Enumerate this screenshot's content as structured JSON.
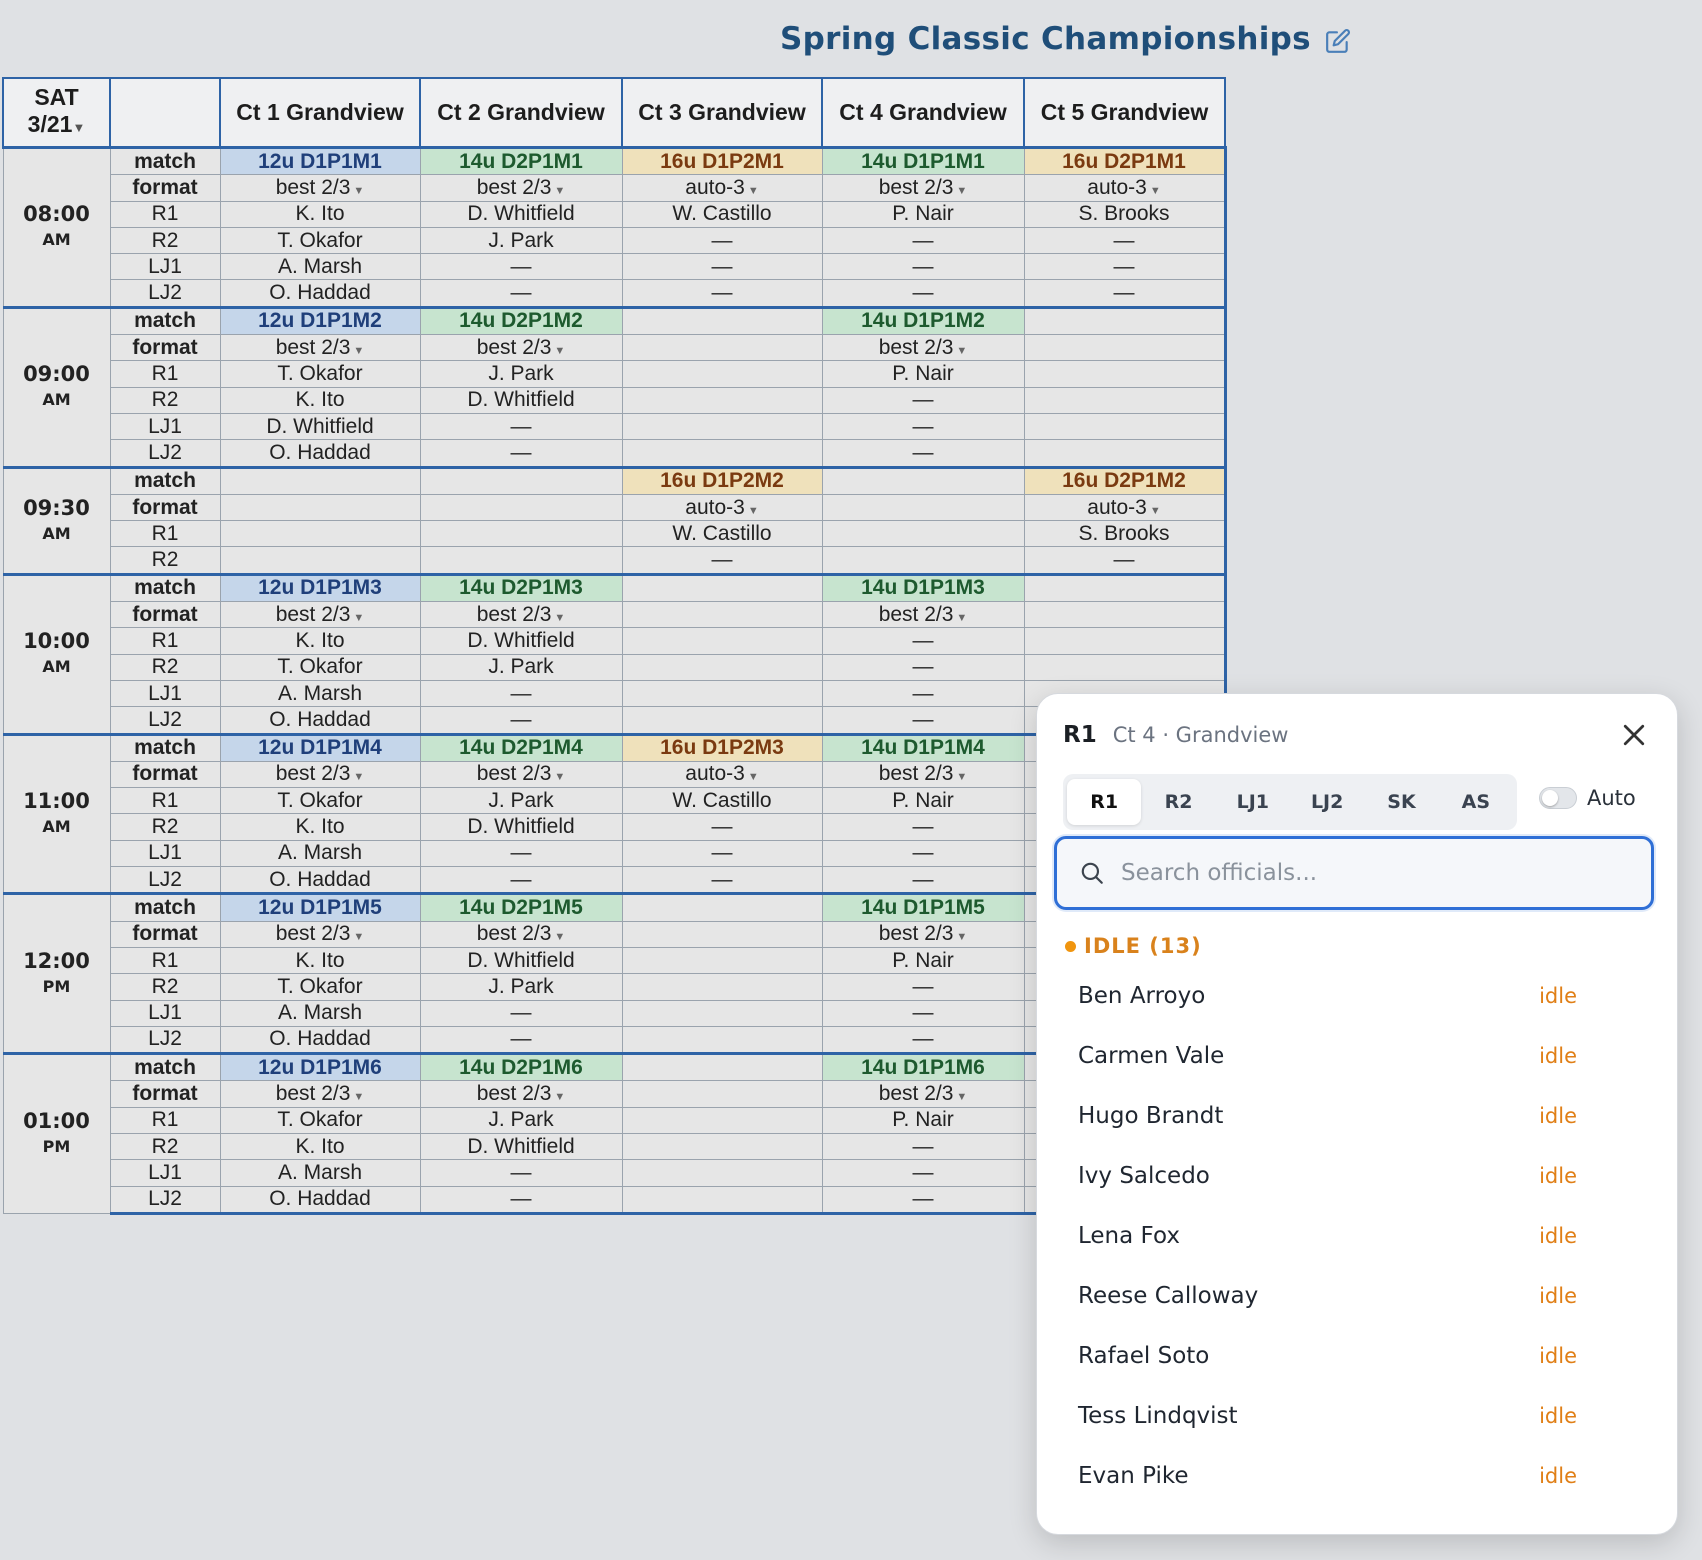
{
  "title": "Spring Classic Championships",
  "header": {
    "date_day": "SAT",
    "date_value": "3/21",
    "courts": [
      "Ct 1 Grandview",
      "Ct 2 Grandview",
      "Ct 3 Grandview",
      "Ct 4 Grandview",
      "Ct 5 Grandview"
    ]
  },
  "blocks": [
    {
      "time": "08:00",
      "ampm": "AM",
      "rows": [
        {
          "role": "match",
          "cells": [
            "12u D1P1M1",
            "14u D2P1M1",
            "16u D1P2M1",
            "14u D1P1M1",
            "16u D2P1M1"
          ]
        },
        {
          "role": "format",
          "cells": [
            "best 2/3",
            "best 2/3",
            "auto-3",
            "best 2/3",
            "auto-3"
          ]
        },
        {
          "role": "R1",
          "cells": [
            "K. Ito",
            "D. Whitfield",
            "W. Castillo",
            "P. Nair",
            "S. Brooks"
          ]
        },
        {
          "role": "R2",
          "cells": [
            "T. Okafor",
            "J. Park",
            "—",
            "—",
            "—"
          ]
        },
        {
          "role": "LJ1",
          "cells": [
            "A. Marsh",
            "—",
            "—",
            "—",
            "—"
          ]
        },
        {
          "role": "LJ2",
          "cells": [
            "O. Haddad",
            "—",
            "—",
            "—",
            "—"
          ]
        }
      ]
    },
    {
      "time": "09:00",
      "ampm": "AM",
      "rows": [
        {
          "role": "match",
          "cells": [
            "12u D1P1M2",
            "14u D2P1M2",
            "",
            "14u D1P1M2",
            ""
          ]
        },
        {
          "role": "format",
          "cells": [
            "best 2/3",
            "best 2/3",
            "",
            "best 2/3",
            ""
          ]
        },
        {
          "role": "R1",
          "cells": [
            "T. Okafor",
            "J. Park",
            "",
            "P. Nair",
            ""
          ]
        },
        {
          "role": "R2",
          "cells": [
            "K. Ito",
            "D. Whitfield",
            "",
            "—",
            ""
          ]
        },
        {
          "role": "LJ1",
          "cells": [
            "D. Whitfield",
            "—",
            "",
            "—",
            ""
          ]
        },
        {
          "role": "LJ2",
          "cells": [
            "O. Haddad",
            "—",
            "",
            "—",
            ""
          ]
        }
      ]
    },
    {
      "time": "09:30",
      "ampm": "AM",
      "rows": [
        {
          "role": "match",
          "cells": [
            "",
            "",
            "16u D1P2M2",
            "",
            "16u D2P1M2"
          ]
        },
        {
          "role": "format",
          "cells": [
            "",
            "",
            "auto-3",
            "",
            "auto-3"
          ]
        },
        {
          "role": "R1",
          "cells": [
            "",
            "",
            "W. Castillo",
            "",
            "S. Brooks"
          ]
        },
        {
          "role": "R2",
          "cells": [
            "",
            "",
            "—",
            "",
            "—"
          ]
        }
      ]
    },
    {
      "time": "10:00",
      "ampm": "AM",
      "rows": [
        {
          "role": "match",
          "cells": [
            "12u D1P1M3",
            "14u D2P1M3",
            "",
            "14u D1P1M3",
            ""
          ]
        },
        {
          "role": "format",
          "cells": [
            "best 2/3",
            "best 2/3",
            "",
            "best 2/3",
            ""
          ]
        },
        {
          "role": "R1",
          "cells": [
            "K. Ito",
            "D. Whitfield",
            "",
            "—",
            ""
          ]
        },
        {
          "role": "R2",
          "cells": [
            "T. Okafor",
            "J. Park",
            "",
            "—",
            ""
          ]
        },
        {
          "role": "LJ1",
          "cells": [
            "A. Marsh",
            "—",
            "",
            "—",
            ""
          ]
        },
        {
          "role": "LJ2",
          "cells": [
            "O. Haddad",
            "—",
            "",
            "—",
            ""
          ]
        }
      ]
    },
    {
      "time": "11:00",
      "ampm": "AM",
      "rows": [
        {
          "role": "match",
          "cells": [
            "12u D1P1M4",
            "14u D2P1M4",
            "16u D1P2M3",
            "14u D1P1M4",
            ""
          ]
        },
        {
          "role": "format",
          "cells": [
            "best 2/3",
            "best 2/3",
            "auto-3",
            "best 2/3",
            ""
          ]
        },
        {
          "role": "R1",
          "cells": [
            "T. Okafor",
            "J. Park",
            "W. Castillo",
            "P. Nair",
            ""
          ]
        },
        {
          "role": "R2",
          "cells": [
            "K. Ito",
            "D. Whitfield",
            "—",
            "—",
            ""
          ]
        },
        {
          "role": "LJ1",
          "cells": [
            "A. Marsh",
            "—",
            "—",
            "—",
            ""
          ]
        },
        {
          "role": "LJ2",
          "cells": [
            "O. Haddad",
            "—",
            "—",
            "—",
            ""
          ]
        }
      ]
    },
    {
      "time": "12:00",
      "ampm": "PM",
      "rows": [
        {
          "role": "match",
          "cells": [
            "12u D1P1M5",
            "14u D2P1M5",
            "",
            "14u D1P1M5",
            ""
          ]
        },
        {
          "role": "format",
          "cells": [
            "best 2/3",
            "best 2/3",
            "",
            "best 2/3",
            ""
          ]
        },
        {
          "role": "R1",
          "cells": [
            "K. Ito",
            "D. Whitfield",
            "",
            "P. Nair",
            ""
          ]
        },
        {
          "role": "R2",
          "cells": [
            "T. Okafor",
            "J. Park",
            "",
            "—",
            ""
          ]
        },
        {
          "role": "LJ1",
          "cells": [
            "A. Marsh",
            "—",
            "",
            "—",
            ""
          ]
        },
        {
          "role": "LJ2",
          "cells": [
            "O. Haddad",
            "—",
            "",
            "—",
            ""
          ]
        }
      ]
    },
    {
      "time": "01:00",
      "ampm": "PM",
      "rows": [
        {
          "role": "match",
          "cells": [
            "12u D1P1M6",
            "14u D2P1M6",
            "",
            "14u D1P1M6",
            ""
          ]
        },
        {
          "role": "format",
          "cells": [
            "best 2/3",
            "best 2/3",
            "",
            "best 2/3",
            ""
          ]
        },
        {
          "role": "R1",
          "cells": [
            "T. Okafor",
            "J. Park",
            "",
            "P. Nair",
            ""
          ]
        },
        {
          "role": "R2",
          "cells": [
            "K. Ito",
            "D. Whitfield",
            "",
            "—",
            ""
          ]
        },
        {
          "role": "LJ1",
          "cells": [
            "A. Marsh",
            "—",
            "",
            "—",
            ""
          ]
        },
        {
          "role": "LJ2",
          "cells": [
            "O. Haddad",
            "—",
            "",
            "—",
            ""
          ]
        }
      ]
    }
  ],
  "popup": {
    "role": "R1",
    "court": "Ct 4 · Grandview",
    "tabs": [
      "R1",
      "R2",
      "LJ1",
      "LJ2",
      "SK",
      "AS"
    ],
    "active_tab": "R1",
    "auto_label": "Auto",
    "auto_on": false,
    "search_placeholder": "Search officials...",
    "section_label": "IDLE (13)",
    "officials": [
      {
        "name": "Ben Arroyo",
        "status": "idle"
      },
      {
        "name": "Carmen Vale",
        "status": "idle"
      },
      {
        "name": "Hugo Brandt",
        "status": "idle"
      },
      {
        "name": "Ivy Salcedo",
        "status": "idle"
      },
      {
        "name": "Lena Fox",
        "status": "idle"
      },
      {
        "name": "Reese Calloway",
        "status": "idle"
      },
      {
        "name": "Rafael Soto",
        "status": "idle"
      },
      {
        "name": "Tess Lindqvist",
        "status": "idle"
      },
      {
        "name": "Evan Pike",
        "status": "idle"
      }
    ]
  },
  "colors": {
    "accent_blue": "#2e63a6",
    "title_blue": "#1f4e79",
    "match_12u": "#c5d6ea",
    "match_14u": "#c7e4cf",
    "match_16u": "#efe1bb",
    "idle_orange": "#e07f16",
    "search_focus": "#2f6fd6"
  },
  "icons": {
    "edit": "edit-icon",
    "close": "close-icon",
    "search": "search-icon",
    "caret": "caret-down-icon"
  }
}
